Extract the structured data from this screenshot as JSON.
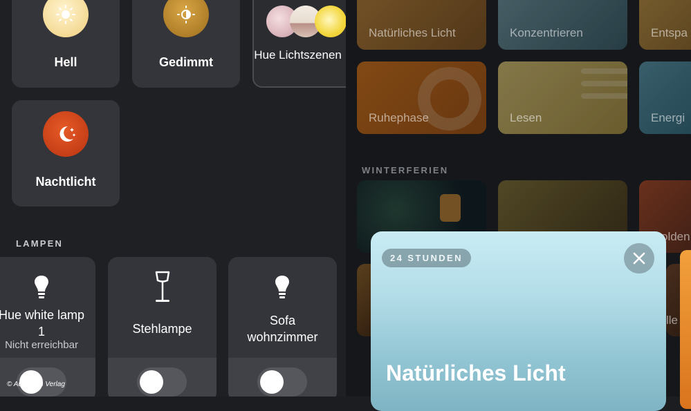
{
  "scenes": [
    {
      "label": "Hell",
      "icon": "sun-icon",
      "color": "#f4dd9a"
    },
    {
      "label": "Gedimmt",
      "icon": "sun-half-icon",
      "color": "#c89530"
    },
    {
      "label": "Hue Lichtszenen ...",
      "icon": "scene-gallery-icon",
      "color": "#e8d2c9"
    },
    {
      "label": "Nachtlicht",
      "icon": "moon-stars-icon",
      "color": "#d8481b"
    }
  ],
  "lamps_section": {
    "title": "LAMPEN"
  },
  "lamps": [
    {
      "name": "Hue white lamp 1",
      "status": "Nicht erreichbar",
      "icon": "bulb-icon"
    },
    {
      "name": "Stehlampe",
      "status": "",
      "icon": "floor-lamp-icon"
    },
    {
      "name": "Sofa wohnzimmer",
      "status": "",
      "icon": "bulb-icon"
    }
  ],
  "gallery": {
    "row1": [
      "Natürliches Licht",
      "Konzentrieren",
      "Entspa"
    ],
    "row2": [
      "Ruhephase",
      "Lesen",
      "Energi"
    ],
    "section_title": "WINTERFERIEN",
    "row3_partial": [
      "olden"
    ],
    "row4_partial": [
      "lle"
    ]
  },
  "popup": {
    "badge": "24 STUNDEN",
    "title": "Natürliches Licht"
  },
  "watermark": "© Auerbach Verlag"
}
